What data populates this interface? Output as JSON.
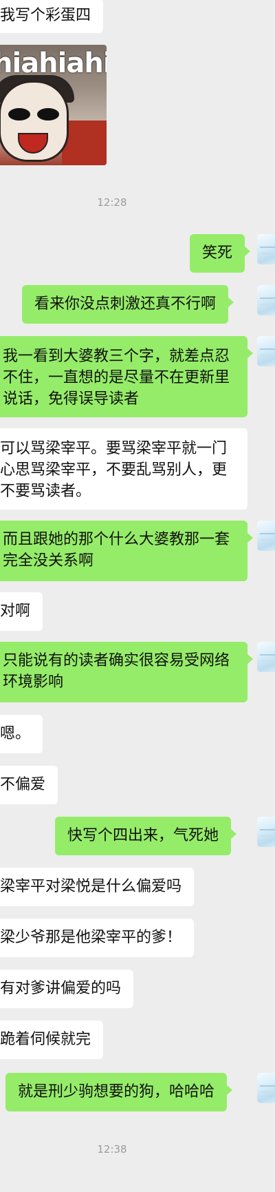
{
  "messages": [
    {
      "side": "in",
      "text": "我写个彩蛋四"
    },
    {
      "side": "in",
      "type": "sticker",
      "caption": "hiahiahia"
    },
    {
      "time": "12:28"
    },
    {
      "side": "out",
      "text": "笑死"
    },
    {
      "side": "out",
      "text": "看来你没点刺激还真不行啊"
    },
    {
      "side": "out",
      "text": "我一看到大婆教三个字，就差点忍不住，一直想的是尽量不在更新里说话，免得误导读者"
    },
    {
      "side": "in",
      "text": "可以骂梁宰平。要骂梁宰平就一门心思骂梁宰平，不要乱骂别人，更不要骂读者。"
    },
    {
      "side": "out",
      "text": "而且跟她的那个什么大婆教那一套完全没关系啊"
    },
    {
      "side": "in",
      "text": "对啊"
    },
    {
      "side": "out",
      "text": "只能说有的读者确实很容易受网络环境影响"
    },
    {
      "side": "in",
      "text": "嗯。"
    },
    {
      "side": "in",
      "text": "不偏爱"
    },
    {
      "side": "out",
      "text": "快写个四出来，气死她"
    },
    {
      "side": "in",
      "text": "梁宰平对梁悦是什么偏爱吗"
    },
    {
      "side": "in",
      "text": "梁少爷那是他梁宰平的爹！"
    },
    {
      "side": "in",
      "text": "有对爹讲偏爱的吗"
    },
    {
      "side": "in",
      "text": "跪着伺候就完"
    },
    {
      "side": "out",
      "text": "就是刑少驹想要的狗，哈哈哈"
    },
    {
      "time": "12:38"
    }
  ],
  "colors": {
    "outgoing": "#95ec69",
    "incoming": "#ffffff",
    "background": "#ededed",
    "timestamp": "#9c9c9c"
  }
}
